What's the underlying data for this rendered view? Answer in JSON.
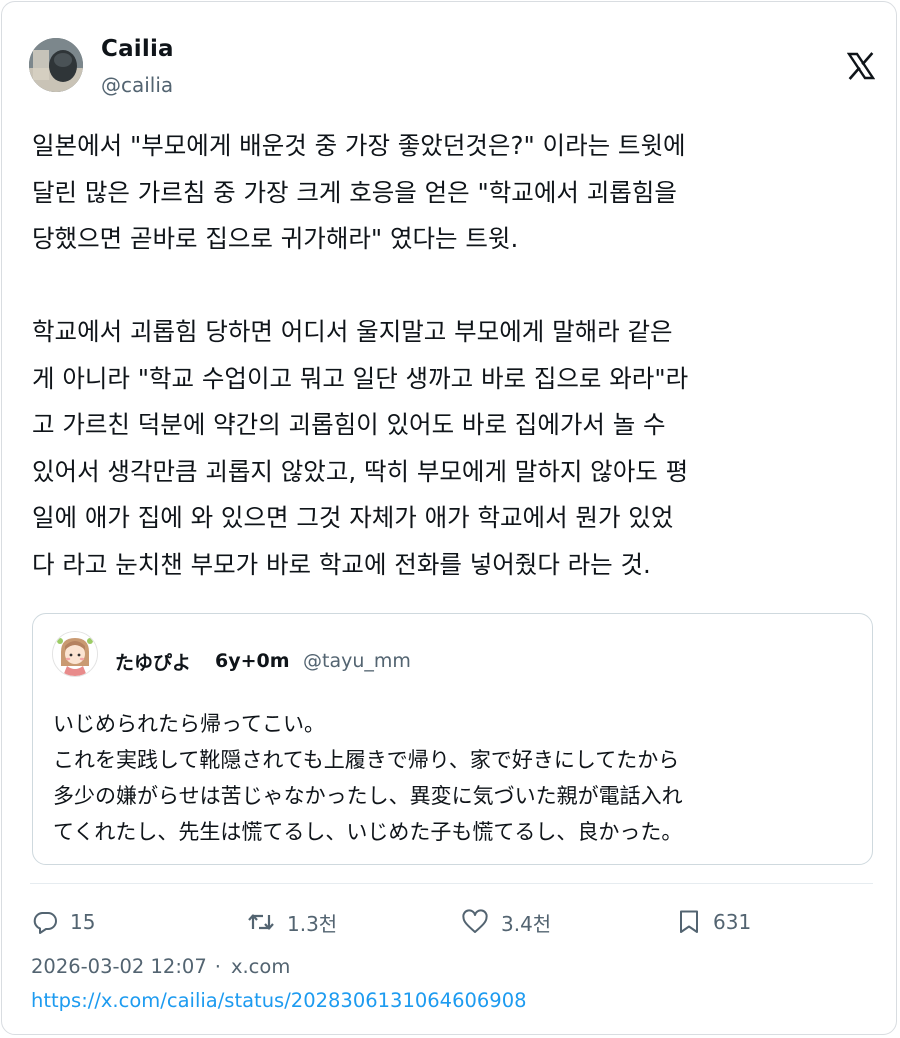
{
  "author": {
    "name": "Cailia",
    "handle": "@cailia"
  },
  "tweet": {
    "text": "일본에서 \"부모에게 배운것 중 가장 좋았던것은?\" 이라는 트윗에\n달린 많은 가르침 중 가장 크게 호응을 얻은 \"학교에서 괴롭힘을\n당했으면 곧바로 집으로 귀가해라\" 였다는 트윗.\n\n학교에서 괴롭힘 당하면 어디서 울지말고 부모에게 말해라 같은\n게 아니라 \"학교 수업이고 뭐고 일단 생까고 바로 집으로 와라\"라\n고 가르친 덕분에 약간의 괴롭힘이 있어도 바로 집에가서 놀 수\n있어서 생각만큼 괴롭지 않았고, 딱히 부모에게 말하지 않아도 평\n일에 애가 집에 와 있으면 그것 자체가 애가 학교에서 뭔가 있었\n다 라고 눈치챈 부모가 바로 학교에 전화를 넣어줬다 라는 것."
  },
  "quote": {
    "name": "たゆぴよ",
    "time": "6y+0m",
    "handle": "@tayu_mm",
    "text": "いじめられたら帰ってこい。\nこれを実践して靴隠されても上履きで帰り、家で好きにしてたから\n多少の嫌がらせは苦じゃなかったし、異変に気づいた親が電話入れ\nてくれたし、先生は慌てるし、いじめた子も慌てるし、良かった。"
  },
  "actions": {
    "replies": "15",
    "retweets": "1.3천",
    "likes": "3.4천",
    "bookmarks": "631"
  },
  "meta": {
    "datetime": "2026-03-02 12:07",
    "separator": "·",
    "source": "x.com",
    "url": "https://x.com/cailia/status/2028306131064606908"
  },
  "icons": {
    "brand": "x-logo-icon",
    "reply": "reply-icon",
    "retweet": "retweet-icon",
    "like": "heart-icon",
    "bookmark": "bookmark-icon"
  },
  "colors": {
    "text": "#0f1419",
    "secondary": "#536471",
    "link": "#1d9bf0",
    "border": "#cfd9de"
  }
}
